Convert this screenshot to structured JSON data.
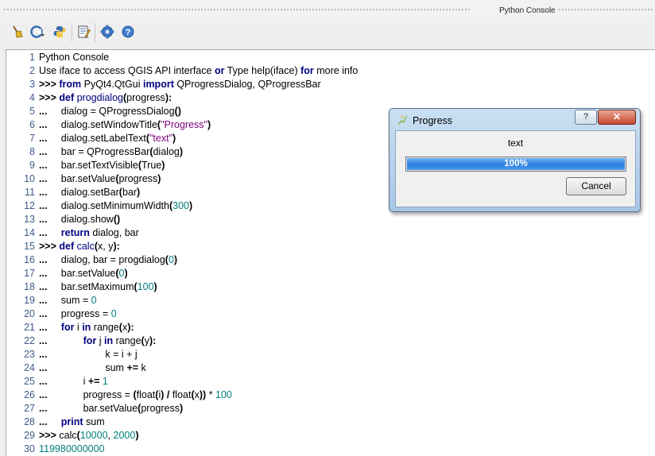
{
  "window": {
    "title": "Python Console"
  },
  "toolbar": {
    "buttons": [
      {
        "icon": "clear-console-icon"
      },
      {
        "icon": "run-command-icon"
      },
      {
        "icon": "python-editor-icon"
      },
      {
        "icon": "script-editor-icon"
      },
      {
        "icon": "settings-icon"
      },
      {
        "icon": "help-icon"
      }
    ]
  },
  "console": {
    "lines": [
      {
        "n": "1",
        "t": [
          [
            "",
            "Python Console"
          ]
        ]
      },
      {
        "n": "2",
        "t": [
          [
            "",
            "Use iface to access QGIS API interface "
          ],
          [
            "kw",
            "or"
          ],
          [
            "",
            " Type help(iface) "
          ],
          [
            "kw",
            "for"
          ],
          [
            "",
            " more info"
          ]
        ]
      },
      {
        "n": "3",
        "t": [
          [
            "op",
            ">>> "
          ],
          [
            "kw",
            "from"
          ],
          [
            "",
            " PyQt4.QtGui "
          ],
          [
            "kw",
            "import"
          ],
          [
            "",
            " QProgressDialog, QProgressBar"
          ]
        ]
      },
      {
        "n": "4",
        "t": [
          [
            "op",
            ">>> "
          ],
          [
            "kw",
            "def"
          ],
          [
            "",
            " "
          ],
          [
            "fn",
            "progdialog"
          ],
          [
            "op",
            "("
          ],
          [
            "",
            "progress"
          ],
          [
            "op",
            "):"
          ]
        ]
      },
      {
        "n": "5",
        "t": [
          [
            "op",
            "...     "
          ],
          [
            "",
            "dialog = QProgressDialog"
          ],
          [
            "op",
            "()"
          ]
        ]
      },
      {
        "n": "6",
        "t": [
          [
            "op",
            "...     "
          ],
          [
            "",
            "dialog.setWindowTitle"
          ],
          [
            "op",
            "("
          ],
          [
            "str",
            "\"Progress\""
          ],
          [
            "op",
            ")"
          ]
        ]
      },
      {
        "n": "7",
        "t": [
          [
            "op",
            "...     "
          ],
          [
            "",
            "dialog.setLabelText"
          ],
          [
            "op",
            "("
          ],
          [
            "str",
            "\"text\""
          ],
          [
            "op",
            ")"
          ]
        ]
      },
      {
        "n": "8",
        "t": [
          [
            "op",
            "...     "
          ],
          [
            "",
            "bar = QProgressBar"
          ],
          [
            "op",
            "("
          ],
          [
            "",
            "dialog"
          ],
          [
            "op",
            ")"
          ]
        ]
      },
      {
        "n": "9",
        "t": [
          [
            "op",
            "...     "
          ],
          [
            "",
            "bar.setTextVisible"
          ],
          [
            "op",
            "("
          ],
          [
            "",
            "True"
          ],
          [
            "op",
            ")"
          ]
        ]
      },
      {
        "n": "10",
        "t": [
          [
            "op",
            "...     "
          ],
          [
            "",
            "bar.setValue"
          ],
          [
            "op",
            "("
          ],
          [
            "",
            "progress"
          ],
          [
            "op",
            ")"
          ]
        ]
      },
      {
        "n": "11",
        "t": [
          [
            "op",
            "...     "
          ],
          [
            "",
            "dialog.setBar"
          ],
          [
            "op",
            "("
          ],
          [
            "",
            "bar"
          ],
          [
            "op",
            ")"
          ]
        ]
      },
      {
        "n": "12",
        "t": [
          [
            "op",
            "...     "
          ],
          [
            "",
            "dialog.setMinimumWidth"
          ],
          [
            "op",
            "("
          ],
          [
            "num",
            "300"
          ],
          [
            "op",
            ")"
          ]
        ]
      },
      {
        "n": "13",
        "t": [
          [
            "op",
            "...     "
          ],
          [
            "",
            "dialog.show"
          ],
          [
            "op",
            "()"
          ]
        ]
      },
      {
        "n": "14",
        "t": [
          [
            "op",
            "...     "
          ],
          [
            "kw",
            "return"
          ],
          [
            "",
            " dialog, bar"
          ]
        ]
      },
      {
        "n": "15",
        "t": [
          [
            "op",
            ">>> "
          ],
          [
            "kw",
            "def"
          ],
          [
            "",
            " "
          ],
          [
            "fn",
            "calc"
          ],
          [
            "op",
            "("
          ],
          [
            "",
            "x, y"
          ],
          [
            "op",
            "):"
          ]
        ]
      },
      {
        "n": "16",
        "t": [
          [
            "op",
            "...     "
          ],
          [
            "",
            "dialog, bar = progdialog"
          ],
          [
            "op",
            "("
          ],
          [
            "num",
            "0"
          ],
          [
            "op",
            ")"
          ]
        ]
      },
      {
        "n": "17",
        "t": [
          [
            "op",
            "...     "
          ],
          [
            "",
            "bar.setValue"
          ],
          [
            "op",
            "("
          ],
          [
            "num",
            "0"
          ],
          [
            "op",
            ")"
          ]
        ]
      },
      {
        "n": "18",
        "t": [
          [
            "op",
            "...     "
          ],
          [
            "",
            "bar.setMaximum"
          ],
          [
            "op",
            "("
          ],
          [
            "num",
            "100"
          ],
          [
            "op",
            ")"
          ]
        ]
      },
      {
        "n": "19",
        "t": [
          [
            "op",
            "...     "
          ],
          [
            "",
            "sum = "
          ],
          [
            "num",
            "0"
          ]
        ]
      },
      {
        "n": "20",
        "t": [
          [
            "op",
            "...     "
          ],
          [
            "",
            "progress = "
          ],
          [
            "num",
            "0"
          ]
        ]
      },
      {
        "n": "21",
        "t": [
          [
            "op",
            "...     "
          ],
          [
            "kw",
            "for"
          ],
          [
            "",
            " i "
          ],
          [
            "kw",
            "in"
          ],
          [
            "",
            " range"
          ],
          [
            "op",
            "("
          ],
          [
            "",
            "x"
          ],
          [
            "op",
            "):"
          ]
        ]
      },
      {
        "n": "22",
        "t": [
          [
            "op",
            "...             "
          ],
          [
            "kw",
            "for"
          ],
          [
            "",
            " j "
          ],
          [
            "kw",
            "in"
          ],
          [
            "",
            " range"
          ],
          [
            "op",
            "("
          ],
          [
            "",
            "y"
          ],
          [
            "op",
            "):"
          ]
        ]
      },
      {
        "n": "23",
        "t": [
          [
            "op",
            "...                     "
          ],
          [
            "",
            "k = i + j"
          ]
        ]
      },
      {
        "n": "24",
        "t": [
          [
            "op",
            "...                     "
          ],
          [
            "",
            "sum "
          ],
          [
            "op",
            "+="
          ],
          [
            "",
            " k"
          ]
        ]
      },
      {
        "n": "25",
        "t": [
          [
            "op",
            "...             "
          ],
          [
            "",
            "i "
          ],
          [
            "op",
            "+="
          ],
          [
            "",
            " "
          ],
          [
            "num",
            "1"
          ]
        ]
      },
      {
        "n": "26",
        "t": [
          [
            "op",
            "...             "
          ],
          [
            "",
            "progress = "
          ],
          [
            "op",
            "("
          ],
          [
            "",
            "float"
          ],
          [
            "op",
            "("
          ],
          [
            "",
            "i"
          ],
          [
            "op",
            ") / "
          ],
          [
            "",
            "float"
          ],
          [
            "op",
            "("
          ],
          [
            "",
            "x"
          ],
          [
            "op",
            "))"
          ],
          [
            "",
            " * "
          ],
          [
            "num",
            "100"
          ]
        ]
      },
      {
        "n": "27",
        "t": [
          [
            "op",
            "...             "
          ],
          [
            "",
            "bar.setValue"
          ],
          [
            "op",
            "("
          ],
          [
            "",
            "progress"
          ],
          [
            "op",
            ")"
          ]
        ]
      },
      {
        "n": "28",
        "t": [
          [
            "op",
            "...     "
          ],
          [
            "kw",
            "print"
          ],
          [
            "",
            " sum"
          ]
        ]
      },
      {
        "n": "29",
        "t": [
          [
            "op",
            ">>> "
          ],
          [
            "",
            "calc"
          ],
          [
            "op",
            "("
          ],
          [
            "num",
            "10000"
          ],
          [
            "",
            ", "
          ],
          [
            "num",
            "2000"
          ],
          [
            "op",
            ")"
          ]
        ]
      },
      {
        "n": "30",
        "t": [
          [
            "num",
            "119980000000"
          ]
        ]
      }
    ]
  },
  "dialog": {
    "title": "Progress",
    "help_label": "?",
    "close_label": "✕",
    "label_text": "text",
    "progress_value": 100,
    "progress_text": "100%",
    "cancel_label": "Cancel"
  }
}
